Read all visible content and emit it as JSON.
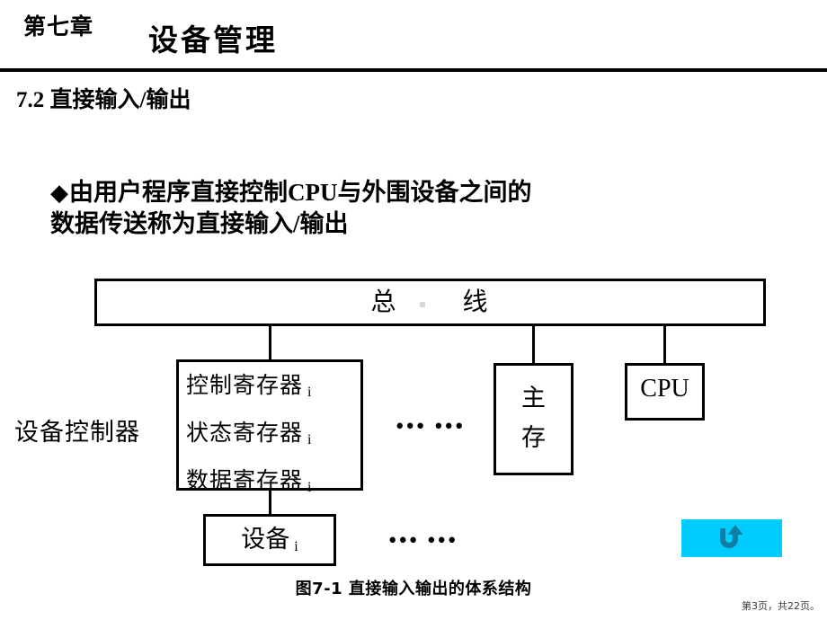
{
  "header": {
    "chapter": "第七章",
    "title": "设备管理"
  },
  "section": {
    "heading": "7.2 直接输入/输出"
  },
  "bullet": {
    "mark": "◆",
    "line1": "由用户程序直接控制CPU与外围设备之间的",
    "line2": "数据传送称为直接输入/输出"
  },
  "diagram": {
    "bus_label": "总        线",
    "controller_label": "设备控制器",
    "registers": [
      {
        "name": "控制寄存器",
        "subscript": "i"
      },
      {
        "name": "状态寄存器",
        "subscript": "i"
      },
      {
        "name": "数据寄存器",
        "subscript": "i"
      }
    ],
    "controller_ellipsis": "••• •••",
    "memory_label_line1": "主",
    "memory_label_line2": "存",
    "cpu_label": "CPU",
    "device_label": "设备",
    "device_subscript": "i",
    "device_ellipsis": "••• •••",
    "caption": "图7-1  直接输入输出的体系结构"
  },
  "return_button": {
    "icon": "u-turn-arrow-icon",
    "background_color": "#00ccff",
    "arrow_color": "#0e7fa3"
  },
  "footer": {
    "page_info": "第3页，共22页。"
  }
}
